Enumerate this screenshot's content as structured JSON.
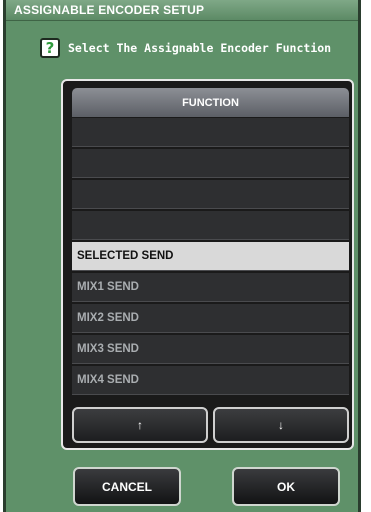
{
  "dialog": {
    "title": "ASSIGNABLE ENCODER SETUP",
    "prompt": "Select The Assignable Encoder Function",
    "help_icon_glyph": "?"
  },
  "list": {
    "header": "FUNCTION",
    "rows": [
      "",
      "",
      "",
      "",
      "SELECTED SEND",
      "MIX1 SEND",
      "MIX2 SEND",
      "MIX3 SEND",
      "MIX4 SEND"
    ],
    "selected_index": 4
  },
  "nav": {
    "up_glyph": "↑",
    "down_glyph": "↓"
  },
  "buttons": {
    "cancel": "CANCEL",
    "ok": "OK"
  },
  "colors": {
    "dialog_background": "#5f9169",
    "panel_background": "#1a1a1a",
    "selected_row": "#d9d9d9"
  }
}
